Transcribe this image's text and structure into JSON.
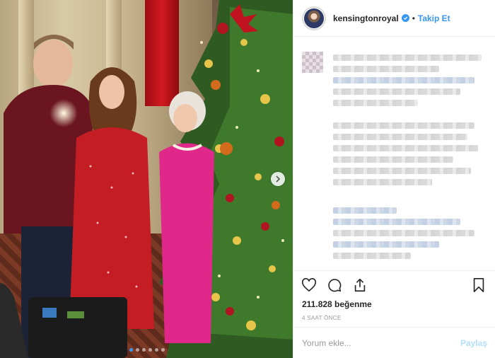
{
  "header": {
    "username": "kensingtonroyal",
    "separator": "•",
    "follow_label": "Takip Et"
  },
  "post": {
    "likes": "211.828 beğenme",
    "time": "4 SAAT ÖNCE"
  },
  "comment_box": {
    "placeholder": "Yorum ekle...",
    "post_label": "Paylaş"
  },
  "carousel": {
    "total_slides": 6,
    "active_slide": 1
  },
  "icons": {
    "like": "heart-icon",
    "comment": "comment-icon",
    "share": "share-icon",
    "save": "bookmark-icon",
    "next": "chevron-right-icon",
    "verified": "verified-badge-icon"
  },
  "colors": {
    "accent": "#3897f0",
    "post_disabled": "#b2dffc",
    "border": "#efefef"
  }
}
